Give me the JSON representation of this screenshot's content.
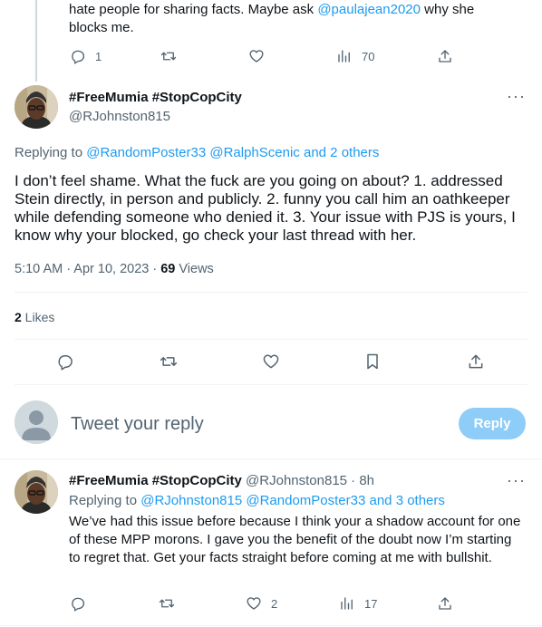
{
  "top_tweet": {
    "text_line1_prefix": "hate people for sharing facts. Maybe ask ",
    "text_line1_mention": "@paulajean2020",
    "text_line1_suffix": " why she",
    "text_line2": "blocks me.",
    "reply_count": "1",
    "views_count": "70"
  },
  "main_tweet": {
    "display_name": "#FreeMumia #StopCopCity",
    "handle": "@RJohnston815",
    "replying_to_label": "Replying to ",
    "replying_mention_1": "@RandomPoster33",
    "replying_mention_2": "@RalphScenic",
    "replying_and_others": "and 2 others",
    "body": "I don’t feel shame. What the fuck are you going on about? 1. addressed Stein directly, in person and publicly. 2. funny you call him an oathkeeper while defending someone who denied it. 3. Your issue with PJS is yours, I know why your blocked, go check your last thread with her.",
    "time": "5:10 AM · Apr 10, 2023 · ",
    "views_number": "69",
    "views_label": " Views",
    "likes_number": "2",
    "likes_label": " Likes"
  },
  "reply_box": {
    "placeholder": "Tweet your reply",
    "button_label": "Reply"
  },
  "bottom_tweet": {
    "display_name": "#FreeMumia #StopCopCity",
    "handle_time": "@RJohnston815 · 8h",
    "replying_to_label": "Replying to ",
    "replying_mention_1": "@RJohnston815",
    "replying_mention_2": "@RandomPoster33",
    "replying_and_others": "and 3 others",
    "body": "We’ve had this issue before because I think your a shadow account for one of these MPP morons. I gave you the benefit of the doubt now I’m starting to regret that. Get your facts straight before coming at me with bullshit.",
    "like_count": "2",
    "views_count": "17"
  },
  "colors": {
    "accent": "#1d9bf0",
    "muted": "#536471",
    "reply_button_disabled": "#8ecdf8"
  }
}
